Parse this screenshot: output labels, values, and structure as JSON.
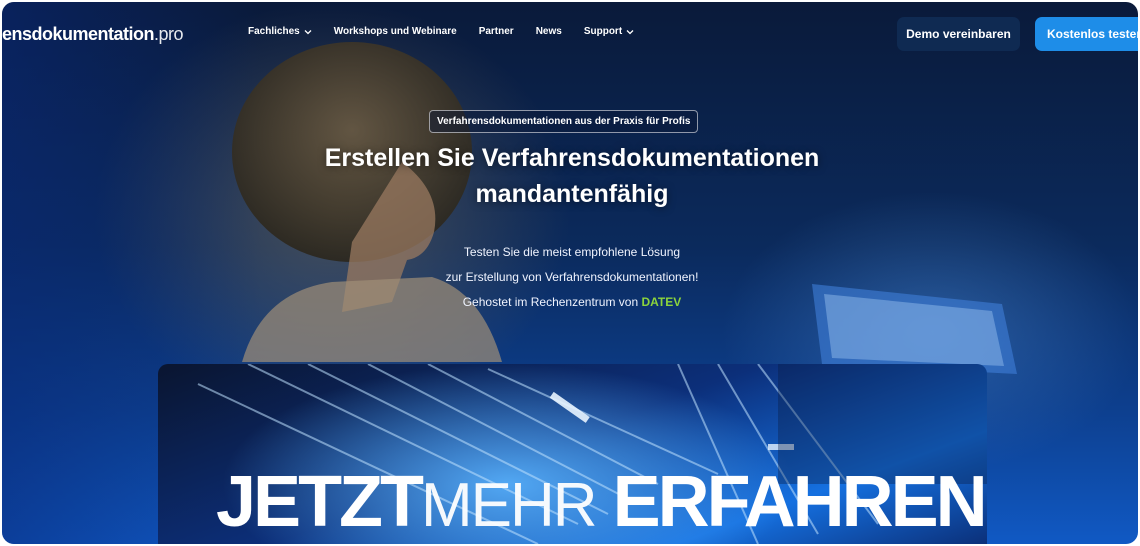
{
  "nav": {
    "logo_main": "ensdokumentation",
    "logo_suffix": ".pro",
    "items": [
      {
        "label": "Fachliches",
        "has_dropdown": true
      },
      {
        "label": "Workshops und Webinare",
        "has_dropdown": false
      },
      {
        "label": "Partner",
        "has_dropdown": false
      },
      {
        "label": "News",
        "has_dropdown": false
      },
      {
        "label": "Support",
        "has_dropdown": true
      }
    ],
    "demo_button": "Demo vereinbaren",
    "trial_button": "Kostenlos testen"
  },
  "hero": {
    "badge": "Verfahrensdokumentationen aus der Praxis für Profis",
    "title_line1": "Erstellen Sie Verfahrensdokumentationen",
    "title_line2": "mandantenfähig",
    "sub_line1": "Testen Sie die meist empfohlene Lösung",
    "sub_line2": "zur Erstellung von Verfahrensdokumentationen!",
    "sub_line3_prefix": "Gehostet im Rechenzentrum von ",
    "sub_line3_highlight": "DATEV"
  },
  "banner": {
    "word1": "JETZT",
    "word2": "MEHR",
    "word3": "ERFAHREN"
  },
  "colors": {
    "accent_blue": "#1e8de8",
    "demo_button_bg": "#0f2a52",
    "datev_green": "#8cd43c"
  }
}
